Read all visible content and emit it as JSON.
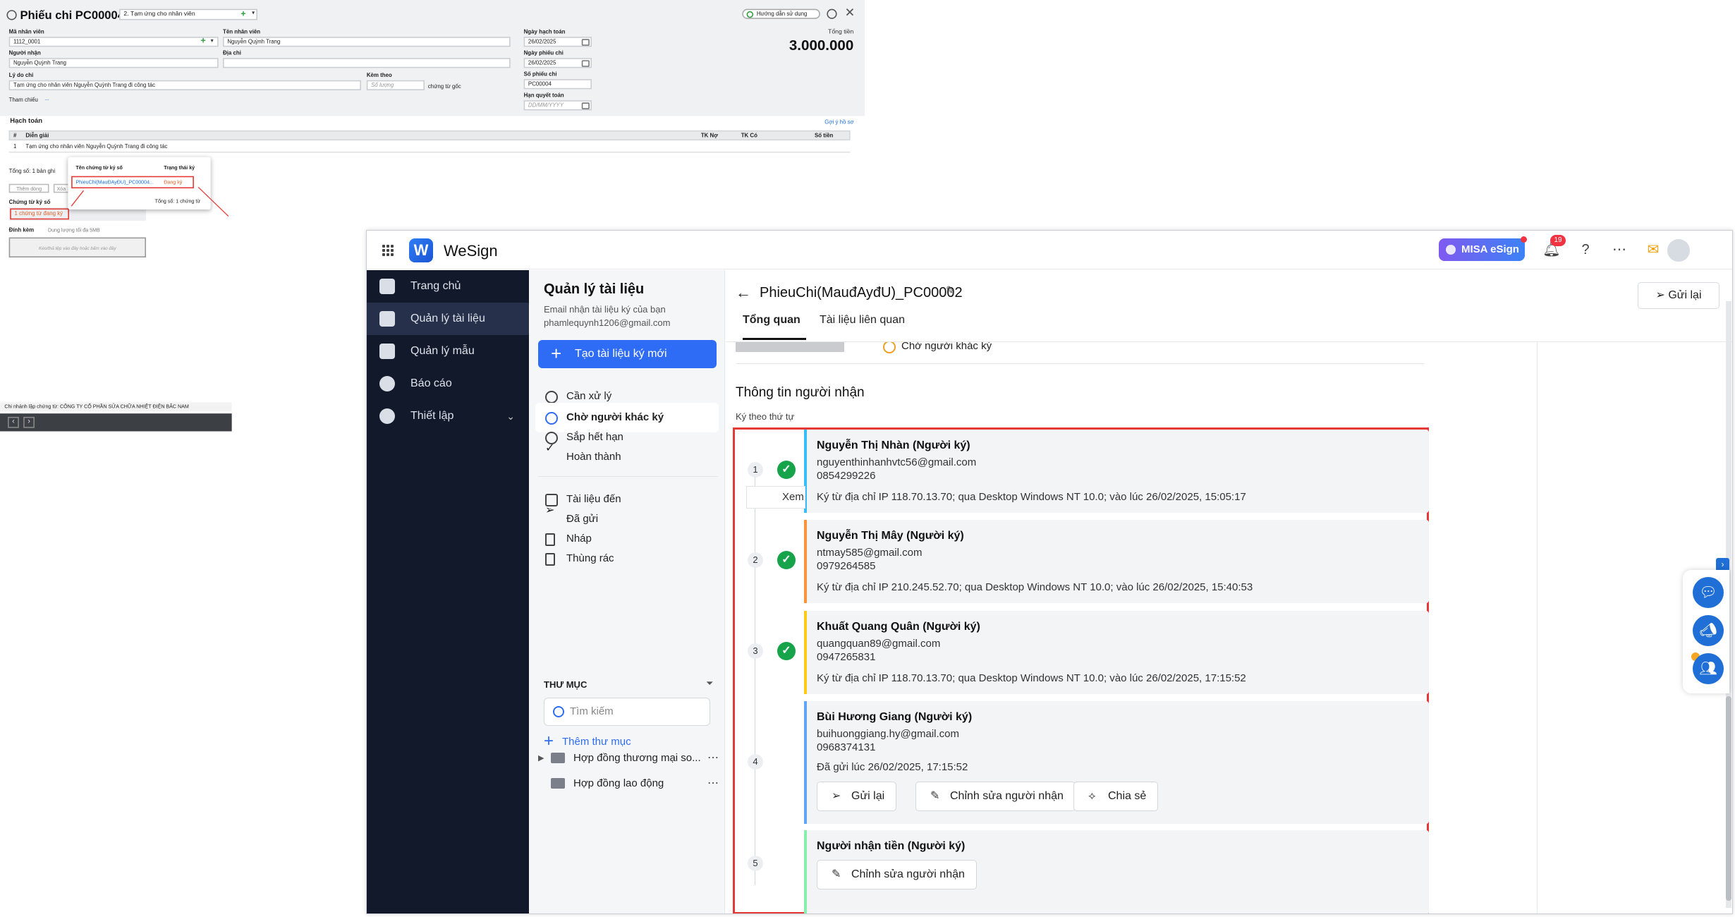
{
  "misa": {
    "title": "Phiếu chi PC00004",
    "type_select": "2. Tạm ứng cho nhân viên",
    "guide": "Hướng dẫn sử dụng",
    "total_label": "Tổng tiền",
    "total_value": "3.000.000",
    "labels": {
      "emp_code": "Mã nhân viên",
      "emp_name": "Tên nhân viên",
      "receiver": "Người nhận",
      "address": "Địa chỉ",
      "reason": "Lý do chi",
      "attach": "Kèm theo",
      "reference": "Tham chiếu",
      "post_date": "Ngày hạch toán",
      "voucher_date": "Ngày phiếu chi",
      "voucher_no": "Số phiếu chi",
      "due_date": "Hạn quyết toán",
      "original_docs": "chứng từ gốc"
    },
    "values": {
      "emp_code": "1112_0001",
      "emp_name": "Nguyễn Quỳnh Trang",
      "receiver": "Nguyễn Quỳnh Trang",
      "reason": "Tạm ứng cho nhân viên Nguyễn Quỳnh Trang đi công tác",
      "attach_placeholder": "Số lượng",
      "post_date": "26/02/2025",
      "voucher_date": "26/02/2025",
      "voucher_no": "PC00004",
      "due_placeholder": "DD/MM/YYYY",
      "reference_dots": "..."
    },
    "accounting": {
      "section": "Hạch toán",
      "suggest": "Gợi ý hồ sơ",
      "cols": [
        "#",
        "Diễn giải",
        "TK Nợ",
        "TK Có",
        "Số tiền"
      ],
      "row_no": "1",
      "row_desc": "Tạm ứng cho nhân viên Nguyễn Quỳnh Trang đi công tác"
    },
    "total_records": "Tổng số: 1 bản ghi",
    "add_row": "Thêm dòng",
    "delete_row": "Xóa",
    "signed_docs_label": "Chứng từ ký số",
    "signed_docs_value": "1 chứng từ đang ký",
    "attach_label": "Đính kèm",
    "attach_limit": "Dung lượng tối đa 5MB",
    "drop_hint": "Kéo/thả tệp vào đây hoặc bấm vào đây",
    "popup": {
      "col1": "Tên chứng từ ký số",
      "col2": "Trạng thái ký",
      "doc": "PhieuChi(MauĐAyĐU)_PC00004...",
      "status": "Đang ký",
      "total": "Tổng số: 1 chứng từ"
    },
    "branch": "Chi nhánh lập chứng từ: CÔNG TY CỔ PHẦN SỬA CHỮA NHIỆT ĐIỆN BẮC NAM"
  },
  "wesign": {
    "app_name": "WeSign",
    "misa_badge": "MISA eSign",
    "bell_count": "19",
    "sidebar": [
      {
        "label": "Trang chủ"
      },
      {
        "label": "Quản lý tài liệu",
        "active": true
      },
      {
        "label": "Quản lý mẫu"
      },
      {
        "label": "Báo cáo"
      },
      {
        "label": "Thiết lập"
      }
    ],
    "docpanel": {
      "title": "Quản lý tài liệu",
      "subtitle": "Email nhận tài liệu ký của bạn",
      "email": "phamlequynh1206@gmail.com",
      "new_doc": "Tạo tài liệu ký mới",
      "status_items": [
        "Cần xử lý",
        "Chờ người khác ký",
        "Sắp hết hạn",
        "Hoàn thành"
      ],
      "box_items": [
        "Tài liệu đến",
        "Đã gửi",
        "Nháp",
        "Thùng rác"
      ],
      "folder_header": "THƯ MỤC",
      "search_placeholder": "Tìm kiếm",
      "add_folder": "Thêm thư mục",
      "folders": [
        "Hợp đồng thương mại so...",
        "Hợp đồng lao động"
      ]
    },
    "doc": {
      "title": "PhieuChi(MauđAyđU)_PC00002",
      "resend": "Gửi lại",
      "tabs": [
        "Tổng quan",
        "Tài liệu liên quan"
      ],
      "status": "Chờ người khác ký",
      "recipients_title": "Thông tin người nhận",
      "order_note": "Ký theo thứ tự",
      "view_tooltip": "Xem",
      "recipients": [
        {
          "step": "1",
          "name": "Nguyễn Thị Nhàn (Người ký)",
          "email": "nguyenthinhanhvtc56@gmail.com",
          "phone": "0854299226",
          "detail": "Ký từ địa chỉ IP 118.70.13.70; qua Desktop Windows NT 10.0; vào lúc 26/02/2025, 15:05:17",
          "bar": "#38bdf8",
          "signed": true
        },
        {
          "step": "2",
          "name": "Nguyễn Thị Mây (Người ký)",
          "email": "ntmay585@gmail.com",
          "phone": "0979264585",
          "detail": "Ký từ địa chỉ IP 210.245.52.70; qua Desktop Windows NT 10.0; vào lúc 26/02/2025, 15:40:53",
          "bar": "#fb923c",
          "signed": true
        },
        {
          "step": "3",
          "name": "Khuất Quang Quân (Người ký)",
          "email": "quangquan89@gmail.com",
          "phone": "0947265831",
          "detail": "Ký từ địa chỉ IP 118.70.13.70; qua Desktop Windows NT 10.0; vào lúc 26/02/2025, 17:15:52",
          "bar": "#facc15",
          "signed": true
        },
        {
          "step": "4",
          "name": "Bùi Hương Giang (Người ký)",
          "email": "buihuonggiang.hy@gmail.com",
          "phone": "0968374131",
          "detail": "Đã gửi lúc 26/02/2025, 17:15:52",
          "bar": "#60a5fa",
          "signed": false,
          "buttons": [
            "Gửi lại",
            "Chỉnh sửa người nhận",
            "Chia sẻ"
          ]
        },
        {
          "step": "5",
          "name": "Người nhận tiền (Người ký)",
          "bar": "#86efac",
          "signed": false,
          "buttons": [
            "Chỉnh sửa người nhận"
          ]
        }
      ]
    }
  }
}
